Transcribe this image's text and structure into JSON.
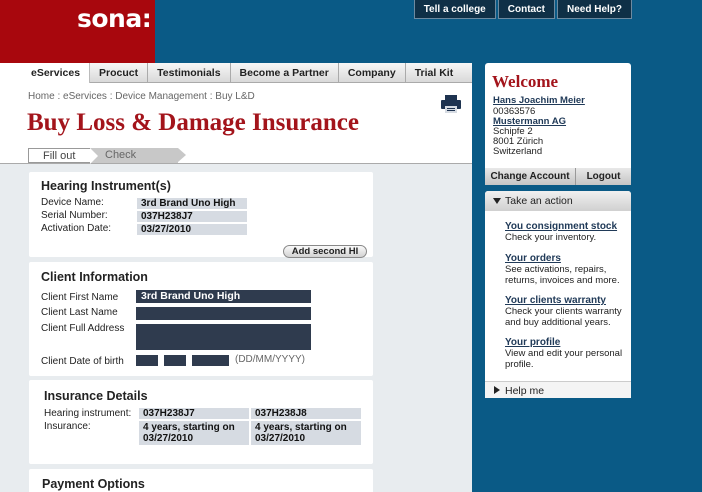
{
  "brand": {
    "logo": "sona:"
  },
  "util_nav": [
    "Tell a college",
    "Contact",
    "Need Help?"
  ],
  "main_nav": [
    "eServices",
    "Procuct",
    "Testimonials",
    "Become a Partner",
    "Company",
    "Trial Kit"
  ],
  "breadcrumb": "Home : eServices : Device Management : Buy L&D",
  "page_title": "Buy Loss & Damage Insurance",
  "steps": {
    "current": "Fill out",
    "next": "Check"
  },
  "hearing": {
    "title": "Hearing Instrument(s)",
    "device_label": "Device Name:",
    "device_value": "3rd Brand Uno High",
    "serial_label": "Serial Number:",
    "serial_value": "037H238J7",
    "activation_label": "Activation Date:",
    "activation_value": "03/27/2010",
    "add_button": "Add second HI"
  },
  "client": {
    "title": "Client Information",
    "first_label": "Client First Name",
    "first_value": "3rd Brand Uno High",
    "last_label": "Client Last Name",
    "address_label": "Client Full Address",
    "dob_label": "Client Date of birth",
    "dob_hint": "(DD/MM/YYYY)"
  },
  "insurance": {
    "title": "Insurance Details",
    "instrument_label": "Hearing instrument:",
    "insurance_label": "Insurance:",
    "col1_instrument": "037H238J7",
    "col2_instrument": "037H238J8",
    "col1_terms": [
      "4 years, starting on",
      "03/27/2010"
    ],
    "col2_terms": [
      "4 years, starting on",
      "03/27/2010"
    ]
  },
  "payment": {
    "title": "Payment Options"
  },
  "welcome": {
    "title": "Welcome",
    "name": "Hans Joachim Meier",
    "account_no": "00363576",
    "company": "Mustermann AG",
    "street": "Schipfe 2",
    "city": "8001 Zürich",
    "country": "Switzerland",
    "change_account": "Change Account",
    "logout": "Logout"
  },
  "actions": {
    "header": "Take an action",
    "items": [
      {
        "title": "You consignment stock",
        "desc": "Check your inventory."
      },
      {
        "title": "Your orders",
        "desc": "See activations, repairs, returns, invoices and more."
      },
      {
        "title": "Your clients warranty",
        "desc": "Check your clients warranty and buy additional years."
      },
      {
        "title": "Your profile",
        "desc": "View and edit your personal profile."
      }
    ],
    "help": "Help me"
  }
}
